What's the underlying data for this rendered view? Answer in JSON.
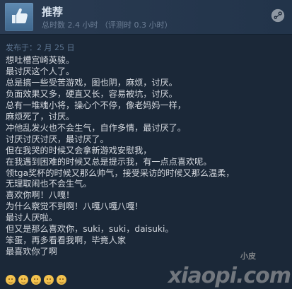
{
  "review": {
    "recommendation_label": "推荐",
    "playtime_text": "总时数 2.4 小时  （评测时 0.3 小时）",
    "posted_text": "发布于：2 月 25 日",
    "body_text": "想吐槽宫崎英骏。\n最讨厌这个人了。\n总是搞一些受苦游戏，图也阴，麻烦，讨厌。\n负面效果又多，硬直又长，容易被坑，讨厌。\n总有一堆魂小将，操心个不停，像老妈妈一样，\n麻烦死了，讨厌。\n冲他乱发火也不会生气，自作多情，最讨厌了。\n讨厌讨厌讨厌，最讨厌了。\n但在我哭的时候又会拿新游戏安慰我，\n在我遇到困难的时候又总是提示我，有一点点喜欢呢。\n领tga奖杯的时候又那么帅气，接受采访的时候又那么温柔，\n无理取闹也不会生气。\n喜欢你啊！八嘎！\n为什么察觉不到啊！八嘎八嘎八嘎！\n最讨人厌啦。\n但又是那么喜欢你，suki，suki，daisuki。\n笨蛋，再多看看我啊，毕竟人家\n最喜欢你了啊"
  },
  "icons": {
    "thumb": "thumbs-up-icon",
    "steam": "steam-icon",
    "emoji": "smiling-face-icon"
  },
  "watermark": {
    "small_text": "小皮",
    "main_text": "xiaopi.com"
  },
  "colors": {
    "background": "#1b2838",
    "header_background": "#2a3b52",
    "thumb_background": "#5f8ab2",
    "title_text": "#d8e3ef",
    "muted_text": "#6d7f96",
    "review_text": "#d5d9df"
  },
  "emoji_count": 5
}
